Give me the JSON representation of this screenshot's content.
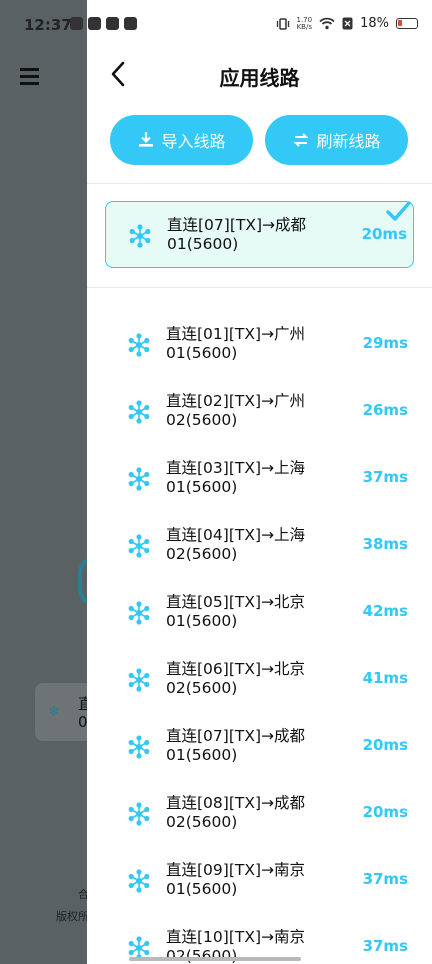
{
  "status_bar": {
    "time": "12:37",
    "net_speed_value": "1.70",
    "net_speed_unit": "KB/s",
    "battery": "18%"
  },
  "background": {
    "card_text_line1": "直",
    "card_text_line2": "0",
    "footer_line1": "合",
    "footer_line2": "版权所"
  },
  "header": {
    "title": "应用线路"
  },
  "actions": {
    "import_label": "导入线路",
    "refresh_label": "刷新线路"
  },
  "selected_line": {
    "name_line1": "直连[07][TX]→成都",
    "name_line2": "01(5600)",
    "ping": "20ms"
  },
  "lines": [
    {
      "name_line1": "直连[01][TX]→广州",
      "name_line2": "01(5600)",
      "ping": "29ms"
    },
    {
      "name_line1": "直连[02][TX]→广州",
      "name_line2": "02(5600)",
      "ping": "26ms"
    },
    {
      "name_line1": "直连[03][TX]→上海",
      "name_line2": "01(5600)",
      "ping": "37ms"
    },
    {
      "name_line1": "直连[04][TX]→上海",
      "name_line2": "02(5600)",
      "ping": "38ms"
    },
    {
      "name_line1": "直连[05][TX]→北京",
      "name_line2": "01(5600)",
      "ping": "42ms"
    },
    {
      "name_line1": "直连[06][TX]→北京",
      "name_line2": "02(5600)",
      "ping": "41ms"
    },
    {
      "name_line1": "直连[07][TX]→成都",
      "name_line2": "01(5600)",
      "ping": "20ms"
    },
    {
      "name_line1": "直连[08][TX]→成都",
      "name_line2": "02(5600)",
      "ping": "20ms"
    },
    {
      "name_line1": "直连[09][TX]→南京",
      "name_line2": "01(5600)",
      "ping": "37ms"
    },
    {
      "name_line1": "直连[10][TX]→南京",
      "name_line2": "02(5600)",
      "ping": "37ms"
    }
  ],
  "colors": {
    "accent": "#33c8f5",
    "selected_bg": "#e6faf6"
  }
}
